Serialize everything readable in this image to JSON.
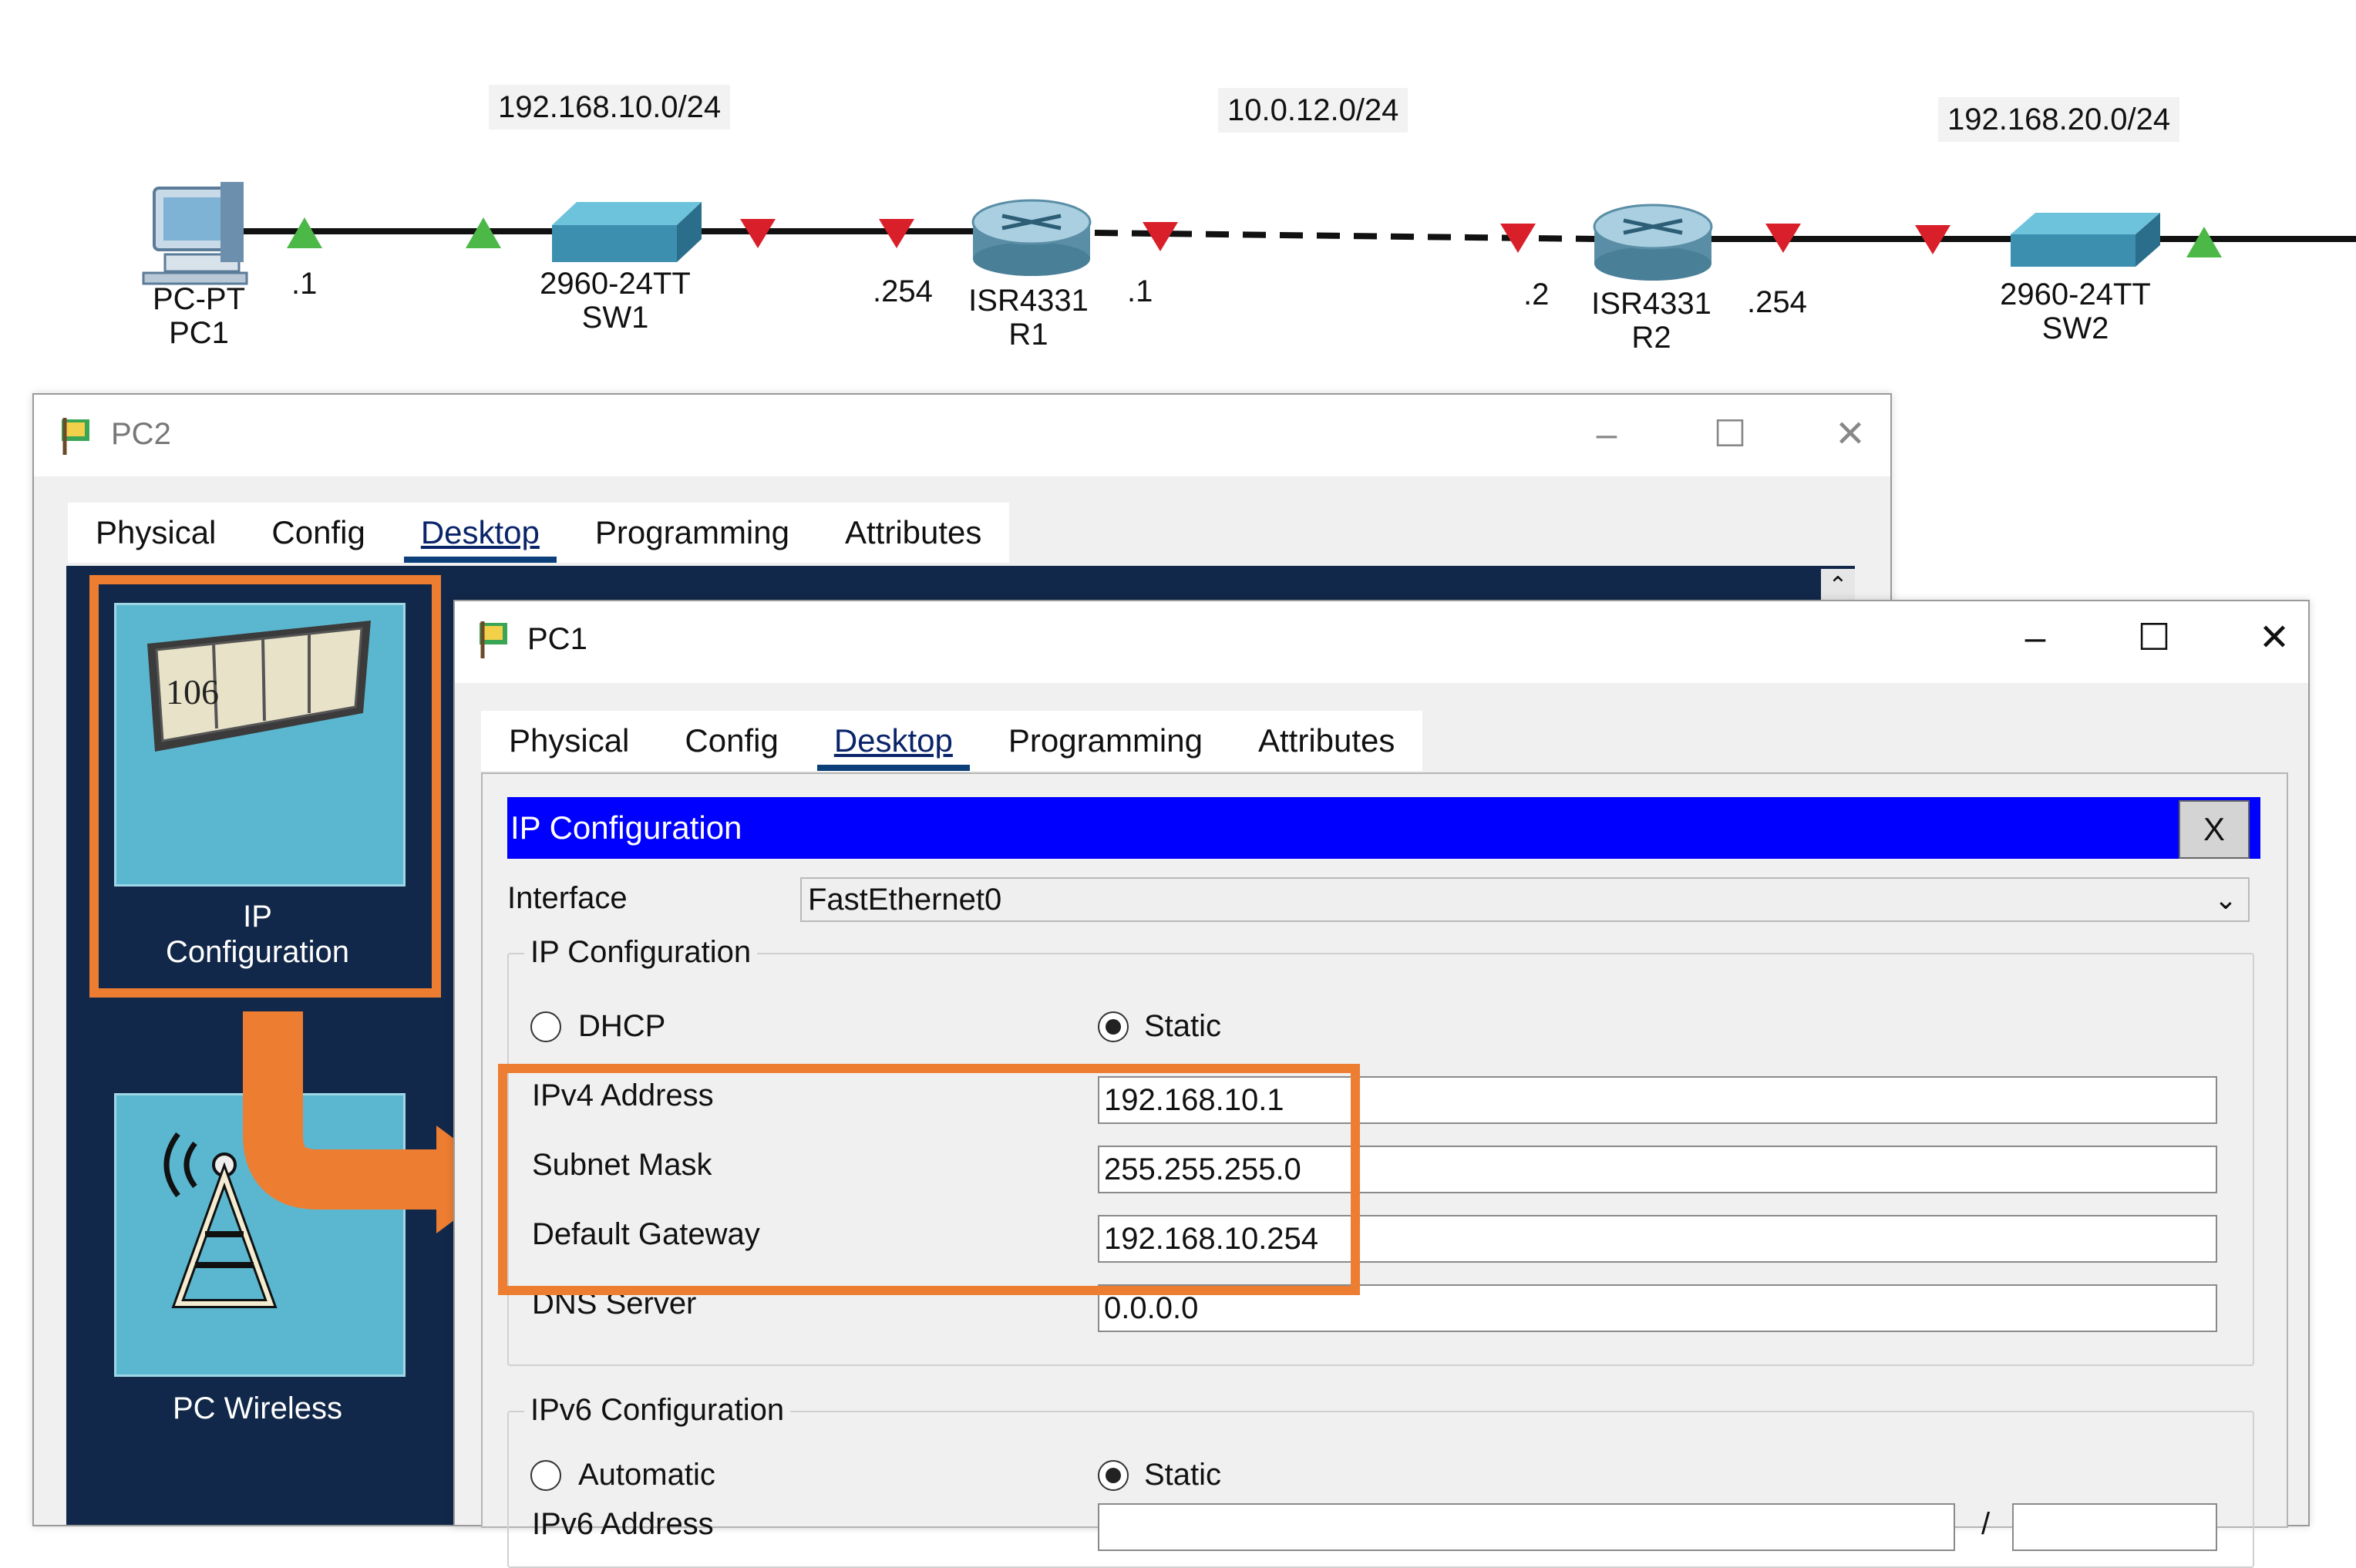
{
  "topology": {
    "networks": [
      "192.168.10.0/24",
      "10.0.12.0/24",
      "192.168.20.0/24"
    ],
    "devices": [
      {
        "type": "PC-PT",
        "name": "PC1"
      },
      {
        "type": "2960-24TT",
        "name": "SW1"
      },
      {
        "type": "ISR4331",
        "name": "R1"
      },
      {
        "type": "ISR4331",
        "name": "R2"
      },
      {
        "type": "2960-24TT",
        "name": "SW2"
      }
    ],
    "ports": [
      ".1",
      ".254",
      ".1",
      ".2",
      ".254"
    ]
  },
  "pc2_window": {
    "title": "PC2",
    "tabs": [
      "Physical",
      "Config",
      "Desktop",
      "Programming",
      "Attributes"
    ],
    "active_tab": "Desktop",
    "apps": [
      {
        "label_line1": "IP",
        "label_line2": "Configuration",
        "icon": "ip-config-icon",
        "icon_text": "106"
      },
      {
        "label": "PC Wireless",
        "icon": "wireless-tower-icon"
      }
    ]
  },
  "pc1_window": {
    "title": "PC1",
    "tabs": [
      "Physical",
      "Config",
      "Desktop",
      "Programming",
      "Attributes"
    ],
    "active_tab": "Desktop",
    "ip_config": {
      "header": "IP Configuration",
      "close_label": "X",
      "interface_label": "Interface",
      "interface_value": "FastEthernet0",
      "ipv4_group_title": "IP Configuration",
      "dhcp_label": "DHCP",
      "static_label": "Static",
      "ipv4_mode": "Static",
      "ipv4_address_label": "IPv4 Address",
      "ipv4_address": "192.168.10.1",
      "subnet_mask_label": "Subnet Mask",
      "subnet_mask": "255.255.255.0",
      "gateway_label": "Default Gateway",
      "gateway": "192.168.10.254",
      "dns_label": "DNS Server",
      "dns": "0.0.0.0",
      "ipv6_group_title": "IPv6 Configuration",
      "automatic_label": "Automatic",
      "static6_label": "Static",
      "ipv6_mode": "Static",
      "ipv6_address_label": "IPv6 Address",
      "ipv6_slash": "/"
    }
  },
  "colors": {
    "highlight": "#ed7d31",
    "ipc_header": "#0000ff",
    "desktop_bg": "#12284a",
    "tile_bg": "#5bb7d0",
    "port_up": "#4cb848",
    "port_down": "#d9202a"
  }
}
